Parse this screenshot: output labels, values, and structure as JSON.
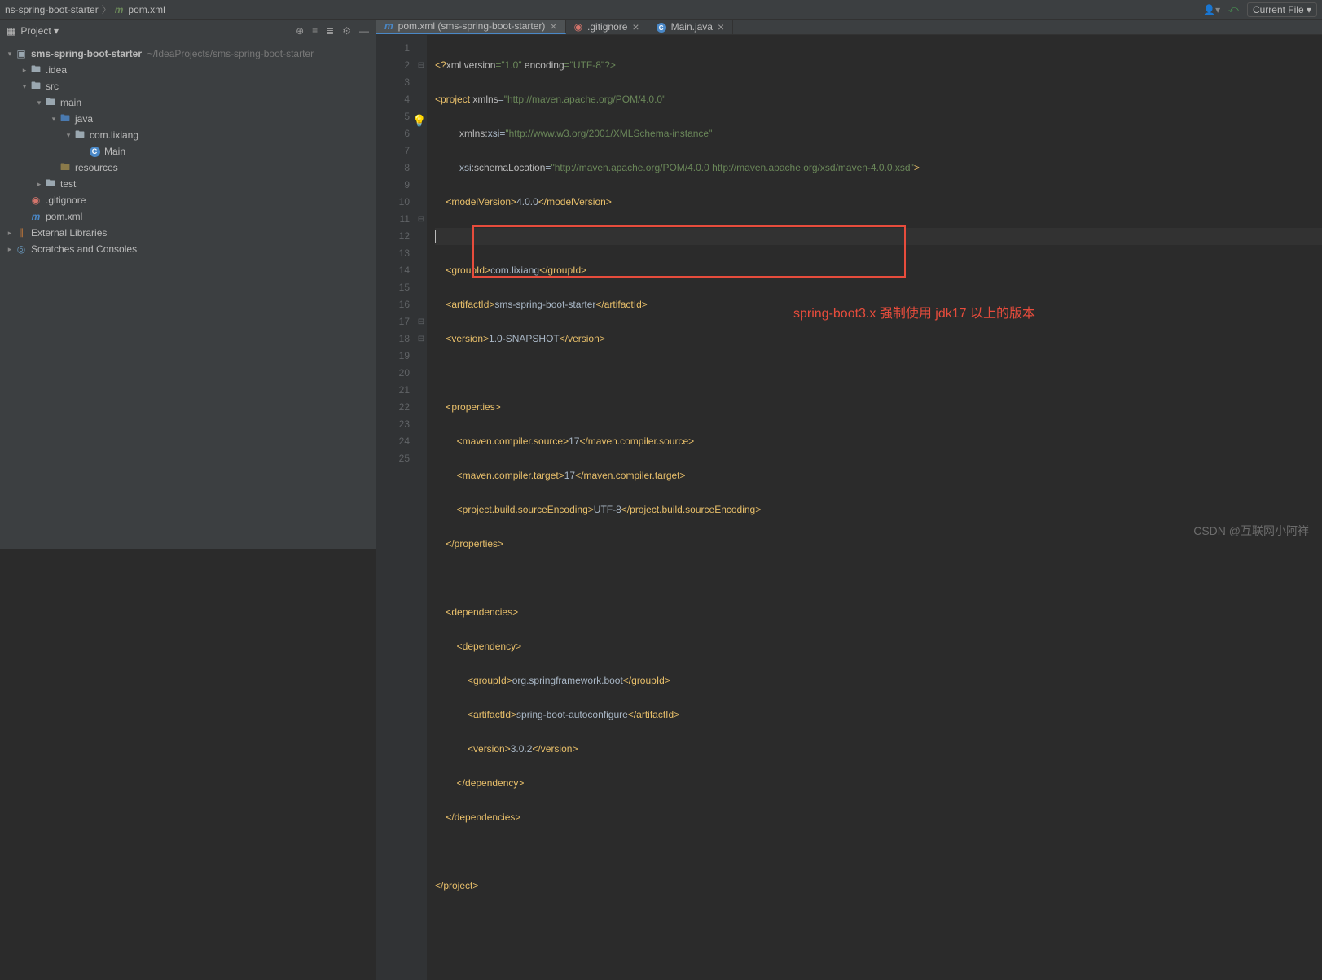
{
  "breadcrumb": {
    "item1": "ns-spring-boot-starter",
    "item2": "pom.xml"
  },
  "topbar": {
    "currentFile": "Current File"
  },
  "sidebar": {
    "header": "Project",
    "tree": {
      "root": {
        "label": "sms-spring-boot-starter",
        "path": "~/IdeaProjects/sms-spring-boot-starter"
      },
      "idea": ".idea",
      "src": "src",
      "main": "main",
      "java": "java",
      "pkg": "com.lixiang",
      "cls": "Main",
      "resources": "resources",
      "test": "test",
      "gitignore": ".gitignore",
      "pom": "pom.xml",
      "extlib": "External Libraries",
      "scratches": "Scratches and Consoles"
    }
  },
  "tabs": {
    "t1": "pom.xml (sms-spring-boot-starter)",
    "t2": ".gitignore",
    "t3": "Main.java"
  },
  "annotation": "spring-boot3.x 强制使用 jdk17 以上的版本",
  "watermark": "CSDN @互联网小阿祥",
  "code": {
    "l1": {
      "a": "<?",
      "b": "xml version",
      "c": "=\"1.0\" ",
      "d": "encoding",
      "e": "=\"UTF-8\"?>"
    },
    "l2": {
      "a": "<project ",
      "b": "xmlns",
      "c": "=",
      "d": "\"http://maven.apache.org/POM/4.0.0\""
    },
    "l3": {
      "a": "         ",
      "b": "xmlns:",
      "c": "xsi",
      "d": "=",
      "e": "\"http://www.w3.org/2001/XMLSchema-instance\""
    },
    "l4": {
      "a": "         ",
      "b": "xsi",
      "c": ":schemaLocation",
      "d": "=",
      "e": "\"http://maven.apache.org/POM/4.0.0 http://maven.apache.org/xsd/maven-4.0.0.xsd\"",
      "f": ">"
    },
    "l5": {
      "a": "    <modelVersion>",
      "b": "4.0.0",
      "c": "</modelVersion>"
    },
    "l7": {
      "a": "    <groupId>",
      "b": "com.lixiang",
      "c": "</groupId>"
    },
    "l8": {
      "a": "    <artifactId>",
      "b": "sms-spring-boot-starter",
      "c": "</artifactId>"
    },
    "l9": {
      "a": "    <version>",
      "b": "1.0-SNAPSHOT",
      "c": "</version>"
    },
    "l11": {
      "a": "    <properties>"
    },
    "l12": {
      "a": "        <maven.compiler.source>",
      "b": "17",
      "c": "</maven.compiler.source>"
    },
    "l13": {
      "a": "        <maven.compiler.target>",
      "b": "17",
      "c": "</maven.compiler.target>"
    },
    "l14": {
      "a": "        <project.build.sourceEncoding>",
      "b": "UTF-8",
      "c": "</project.build.sourceEncoding>"
    },
    "l15": {
      "a": "    </properties>"
    },
    "l17": {
      "a": "    <dependencies>"
    },
    "l18": {
      "a": "        <dependency>"
    },
    "l19": {
      "a": "            <groupId>",
      "b": "org.springframework.boot",
      "c": "</groupId>"
    },
    "l20": {
      "a": "            <artifactId>",
      "b": "spring-boot-autoconfigure",
      "c": "</artifactId>"
    },
    "l21": {
      "a": "            <version>",
      "b": "3.0.2",
      "c": "</version>"
    },
    "l22": {
      "a": "        </dependency>"
    },
    "l23": {
      "a": "    </dependencies>"
    },
    "l25": {
      "a": "</project>"
    }
  }
}
